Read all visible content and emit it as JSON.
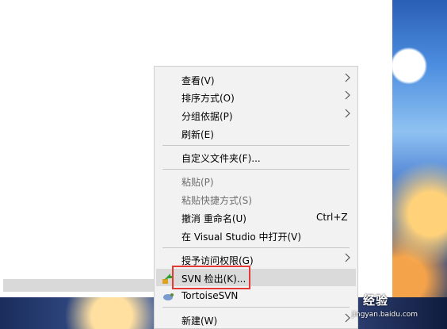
{
  "context_menu": {
    "items": [
      {
        "label": "查看(V)"
      },
      {
        "label": "排序方式(O)"
      },
      {
        "label": "分组依据(P)"
      },
      {
        "label": "刷新(E)"
      },
      {
        "label": "自定义文件夹(F)..."
      },
      {
        "label": "粘贴(P)"
      },
      {
        "label": "粘贴快捷方式(S)"
      },
      {
        "label": "撤消 重命名(U)",
        "shortcut": "Ctrl+Z"
      },
      {
        "label": "在 Visual Studio 中打开(V)"
      },
      {
        "label": "授予访问权限(G)"
      },
      {
        "label": "SVN 检出(K)..."
      },
      {
        "label": "TortoiseSVN"
      },
      {
        "label": "新建(W)"
      }
    ]
  },
  "watermark": {
    "text": "经验",
    "sub": "jingyan.baidu.com"
  },
  "colors": {
    "highlight_box": "#e53935",
    "menu_bg": "#f2f2f2"
  }
}
